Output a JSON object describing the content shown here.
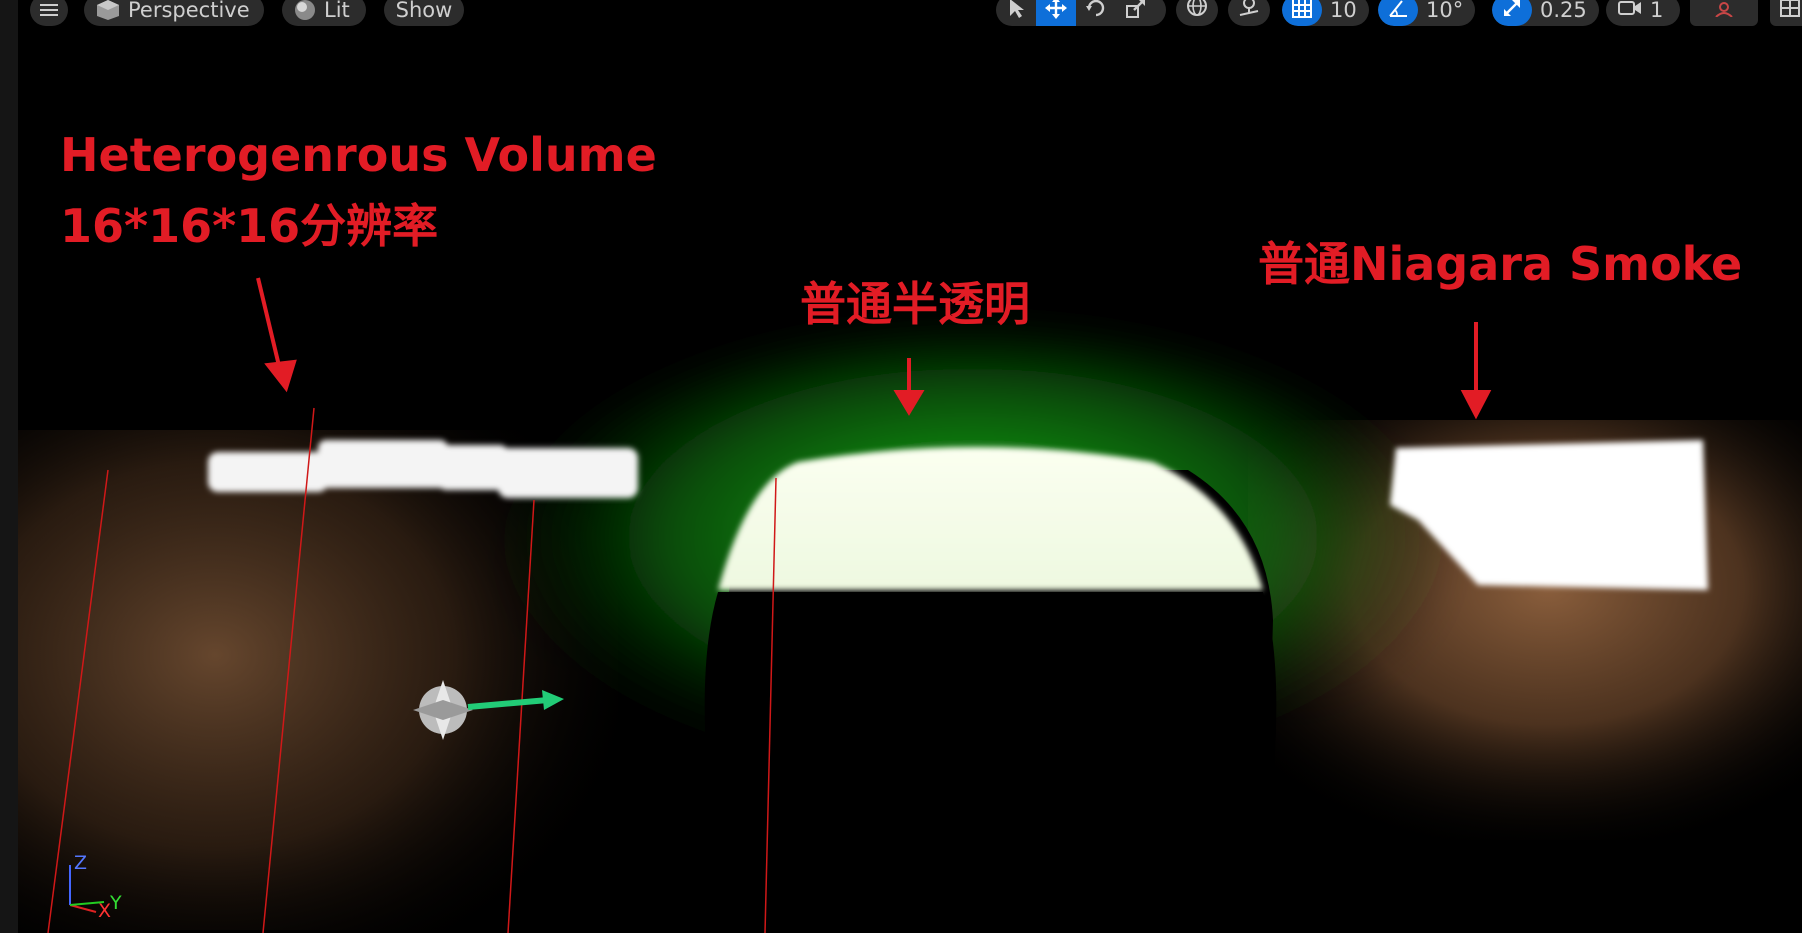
{
  "toolbar": {
    "view_mode": "Perspective",
    "lighting_mode": "Lit",
    "show_label": "Show",
    "grid_snap_value": "10",
    "rotation_snap_value": "10°",
    "scale_snap_value": "0.25",
    "camera_speed_value": "1",
    "transform_tools": [
      "select-icon",
      "move-icon",
      "rotate-icon",
      "scale-icon"
    ],
    "accent_color": "#0e6fd9"
  },
  "annotations": {
    "volume_title": "Heterogenrous Volume",
    "volume_resolution": "16*16*16分辨率",
    "translucent": "普通半透明",
    "niagara_smoke": "普通Niagara Smoke",
    "color": "#e21c25"
  },
  "axis_gizmo": {
    "z": "Z",
    "x": "X",
    "y": "Y"
  },
  "colors": {
    "glow_green": "#22dd22",
    "wood": "#6b4a30"
  }
}
